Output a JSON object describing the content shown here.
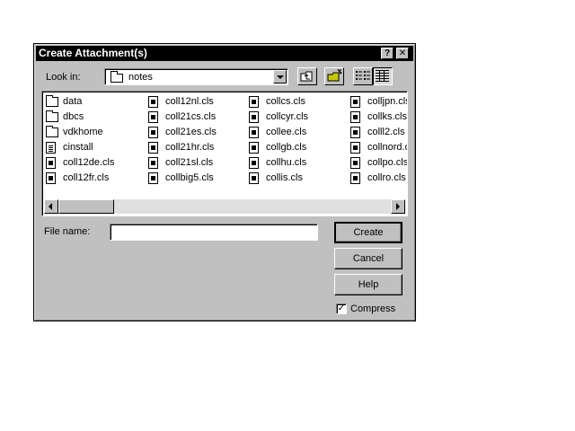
{
  "dialog": {
    "title": "Create Attachment(s)",
    "help_glyph": "?",
    "close_glyph": "✕"
  },
  "look_in": {
    "label": "Look in:",
    "value": "notes"
  },
  "toolbar": {
    "icons": [
      "up-one-level-icon",
      "new-folder-icon",
      "list-view-icon",
      "details-view-icon"
    ]
  },
  "files": [
    {
      "name": "data",
      "type": "folder"
    },
    {
      "name": "dbcs",
      "type": "folder"
    },
    {
      "name": "vdkhome",
      "type": "folder"
    },
    {
      "name": "cinstall",
      "type": "text"
    },
    {
      "name": "coll12de.cls",
      "type": "file"
    },
    {
      "name": "coll12fr.cls",
      "type": "file"
    },
    {
      "name": "coll12nl.cls",
      "type": "file"
    },
    {
      "name": "coll21cs.cls",
      "type": "file"
    },
    {
      "name": "coll21es.cls",
      "type": "file"
    },
    {
      "name": "coll21hr.cls",
      "type": "file"
    },
    {
      "name": "coll21sl.cls",
      "type": "file"
    },
    {
      "name": "collbig5.cls",
      "type": "file"
    },
    {
      "name": "collcs.cls",
      "type": "file"
    },
    {
      "name": "collcyr.cls",
      "type": "file"
    },
    {
      "name": "collee.cls",
      "type": "file"
    },
    {
      "name": "collgb.cls",
      "type": "file"
    },
    {
      "name": "collhu.cls",
      "type": "file"
    },
    {
      "name": "collis.cls",
      "type": "file"
    },
    {
      "name": "colljpn.cls",
      "type": "file"
    },
    {
      "name": "collks.cls",
      "type": "file"
    },
    {
      "name": "colll2.cls",
      "type": "file"
    },
    {
      "name": "collnord.cls",
      "type": "file"
    },
    {
      "name": "collpo.cls",
      "type": "file"
    },
    {
      "name": "collro.cls",
      "type": "file"
    }
  ],
  "filename": {
    "label": "File name:",
    "value": ""
  },
  "buttons": {
    "create": "Create",
    "cancel": "Cancel",
    "help": "Help"
  },
  "compress": {
    "label": "Compress",
    "checked": true,
    "check_glyph": "✓"
  }
}
